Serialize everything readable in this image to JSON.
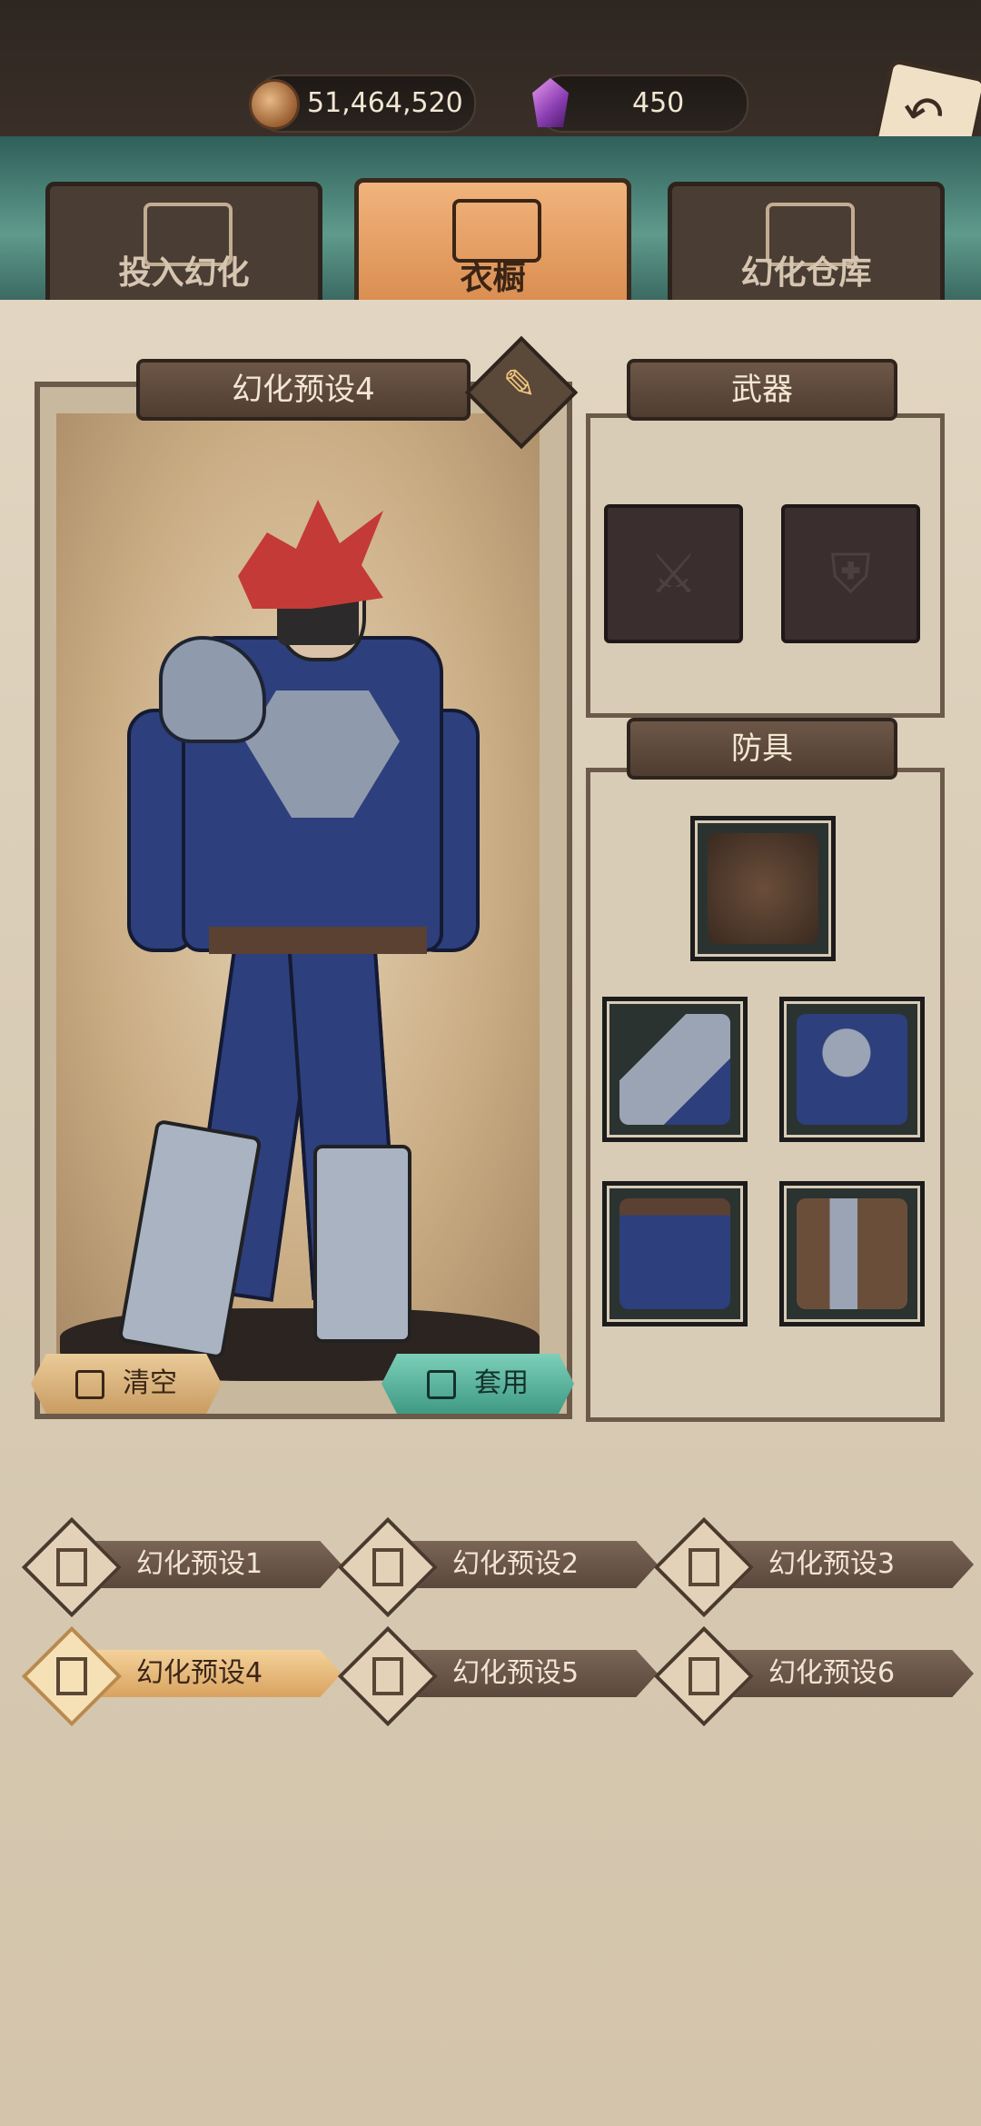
{
  "currency": {
    "coins_value": "51,464,520",
    "gems_value": "450",
    "coin_icon": "coin-icon",
    "gem_icon": "purple-gem-icon"
  },
  "tabs": [
    {
      "label": "投入幻化",
      "icon": "mask-icon",
      "active": false
    },
    {
      "label": "衣橱",
      "icon": "armor-star-icon",
      "active": true
    },
    {
      "label": "幻化仓库",
      "icon": "cabinet-icon",
      "active": false
    }
  ],
  "preview": {
    "title": "幻化预设4",
    "clear_label": "清空",
    "apply_label": "套用"
  },
  "weapons": {
    "title": "武器",
    "slots": [
      "sword-slot-icon",
      "shield-slot-icon"
    ]
  },
  "armor": {
    "title": "防具",
    "items": [
      "helmet-mask-item",
      "bracer-item",
      "chest-armor-item",
      "pants-item",
      "boots-item"
    ]
  },
  "presets": [
    {
      "label": "幻化预设1",
      "active": false
    },
    {
      "label": "幻化预设2",
      "active": false
    },
    {
      "label": "幻化预设3",
      "active": false
    },
    {
      "label": "幻化预设4",
      "active": true
    },
    {
      "label": "幻化预设5",
      "active": false
    },
    {
      "label": "幻化预设6",
      "active": false
    }
  ],
  "colors": {
    "accent_orange": "#d98b4e",
    "apply_teal": "#3f9a84",
    "parchment": "#d9ccb6"
  }
}
